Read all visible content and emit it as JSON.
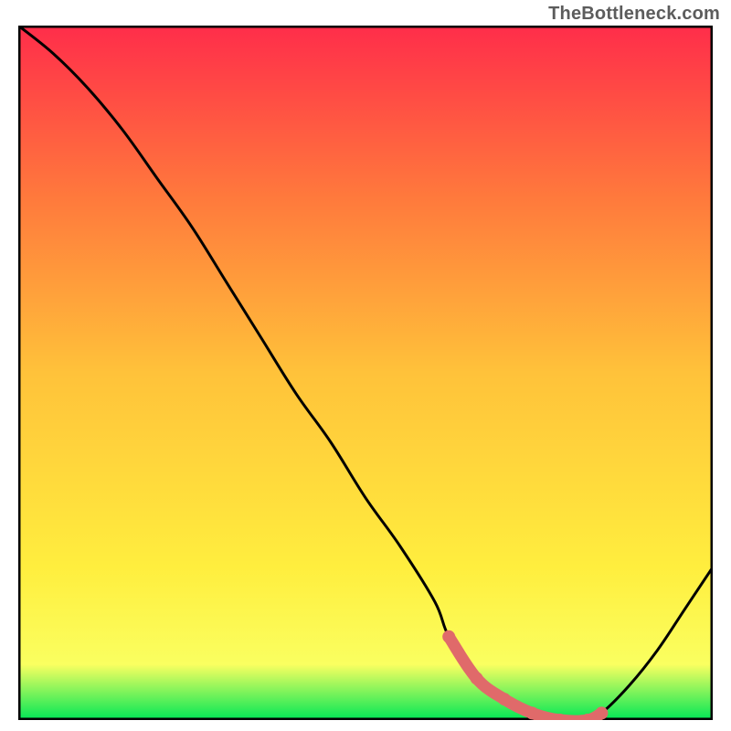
{
  "watermark": "TheBottleneck.com",
  "colors": {
    "gradient_top": "#ff2d4a",
    "gradient_q1": "#ff7a3c",
    "gradient_mid": "#ffc23a",
    "gradient_q3": "#ffee3e",
    "gradient_low": "#faff60",
    "gradient_bottom": "#00e756",
    "frame": "#000000",
    "curve": "#000000",
    "marker": "#e06a6a"
  },
  "chart_data": {
    "type": "line",
    "title": "",
    "xlabel": "",
    "ylabel": "",
    "xlim": [
      0,
      100
    ],
    "ylim": [
      0,
      100
    ],
    "grid": false,
    "legend": null,
    "series": [
      {
        "name": "bottleneck-curve",
        "x": [
          0,
          5,
          10,
          15,
          20,
          25,
          30,
          35,
          40,
          45,
          50,
          55,
          60,
          62,
          66,
          70,
          74,
          78,
          82,
          84,
          88,
          92,
          96,
          100
        ],
        "y": [
          100,
          96,
          91,
          85,
          78,
          71,
          63,
          55,
          47,
          40,
          32,
          25,
          17,
          12,
          6,
          3,
          1,
          0,
          0,
          1,
          5,
          10,
          16,
          22
        ]
      }
    ],
    "highlight_segment": {
      "name": "optimal-range",
      "x": [
        62,
        66,
        70,
        74,
        78,
        82,
        84
      ],
      "y": [
        12,
        6,
        3,
        1,
        0,
        0,
        1
      ]
    }
  }
}
